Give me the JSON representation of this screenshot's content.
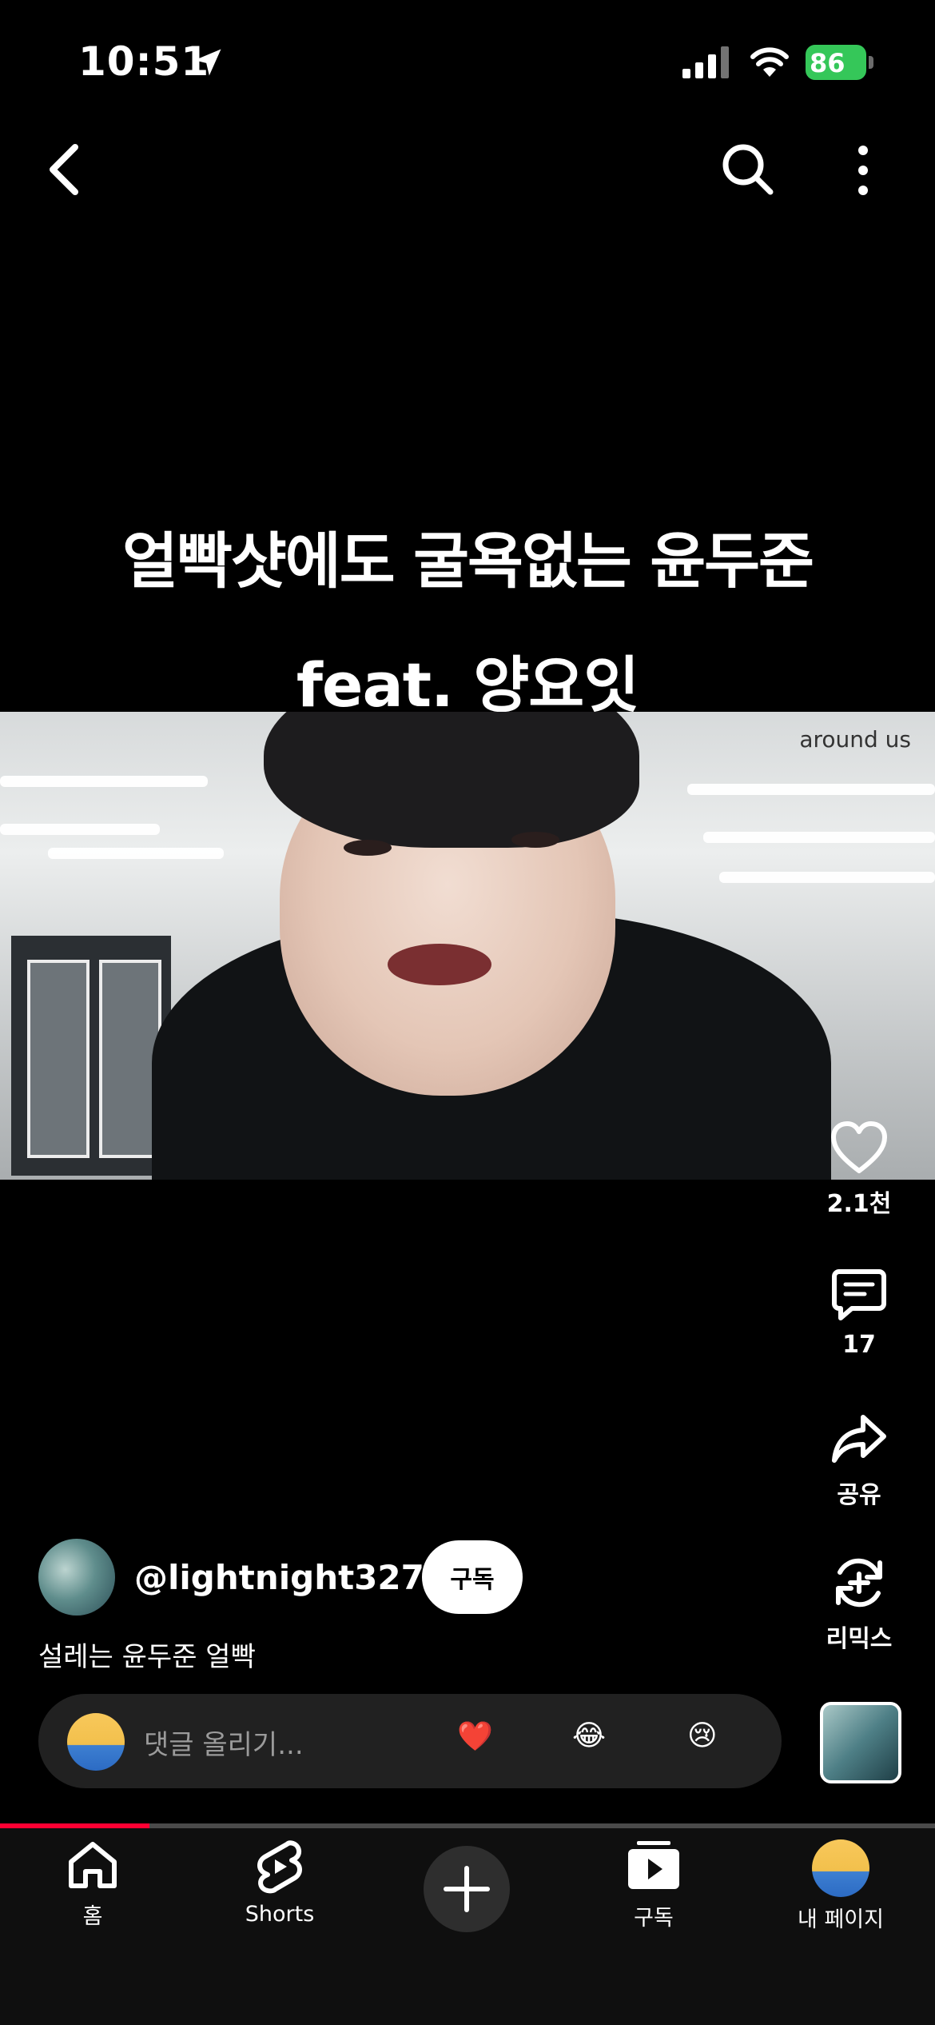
{
  "status_bar": {
    "time": "10:51",
    "battery": "86"
  },
  "video": {
    "caption_line1": "얼빡샷에도 굴욕없는 윤두준",
    "caption_line2": "feat. 양요잇",
    "watermark": "around us",
    "progress_fraction": 0.16
  },
  "actions": {
    "like_count": "2.1천",
    "comment_count": "17",
    "share_label": "공유",
    "remix_label": "리믹스"
  },
  "channel": {
    "handle": "@lightnight3274",
    "subscribe_label": "구독",
    "description": "설레는 윤두준 얼빡"
  },
  "comment_bar": {
    "placeholder": "댓글 올리기...",
    "emojis": [
      "❤️",
      "😂",
      "😢"
    ]
  },
  "bottom_nav": {
    "home": "홈",
    "shorts": "Shorts",
    "subscriptions": "구독",
    "my_page": "내 페이지"
  },
  "colors": {
    "accent": "#ff0033",
    "battery": "#35c759",
    "background": "#000000"
  }
}
